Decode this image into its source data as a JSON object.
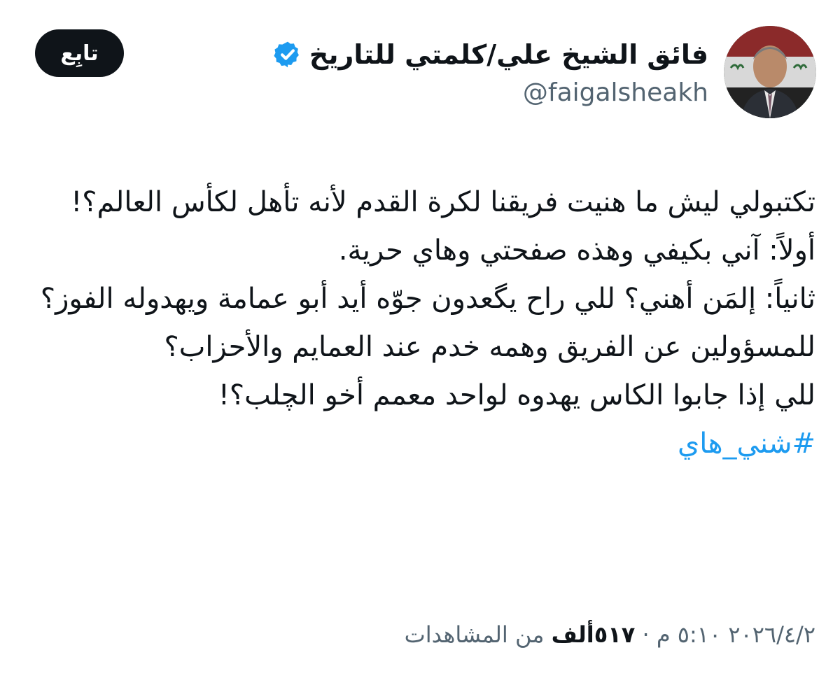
{
  "author": {
    "display_name": "فائق الشيخ علي/كلمتي للتاريخ",
    "handle": "@faigalsheakh",
    "verified_icon": "verified-badge-icon",
    "avatar": "profile-photo"
  },
  "follow_label": "تابِع",
  "tweet": {
    "lines": [
      "تكتبولي ليش ما هنيت فريقنا لكرة القدم لأنه تأهل لكأس العالم؟!",
      "أولاً: آني بكيفي وهذه صفحتي وهاي حرية.",
      "ثانياً: إلمَن أهني؟ للي راح يگعدون جوّه أيد أبو عمامة ويهدوله الفوز؟",
      "للمسؤولين عن الفريق وهمه خدم عند العمايم والأحزاب؟",
      "للي إذا جابوا الكاس يهدوه لواحد معمم أخو الچلب؟!"
    ],
    "hashtag": "#شني_هاي"
  },
  "meta": {
    "date": "٢٠٢٦/٤/٢",
    "time": "٥:١٠ م",
    "separator": "·",
    "views_count": "٥١٧ألف",
    "views_label": "من المشاهدات"
  },
  "colors": {
    "text": "#0f1419",
    "secondary": "#536471",
    "link": "#1d9bf0",
    "verified": "#1d9bf0",
    "follow_bg": "#0f1419"
  }
}
